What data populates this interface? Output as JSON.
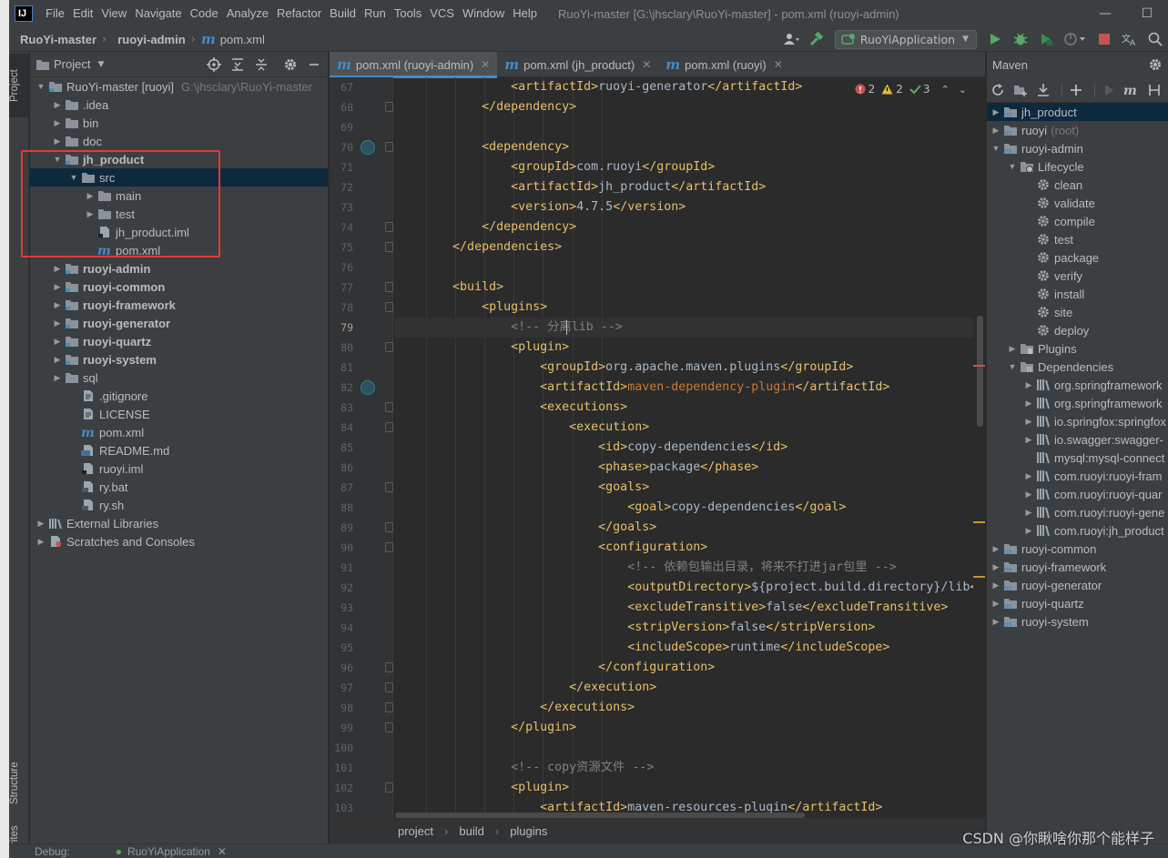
{
  "menubar": {
    "logo": "IJ",
    "items": [
      "File",
      "Edit",
      "View",
      "Navigate",
      "Code",
      "Analyze",
      "Refactor",
      "Build",
      "Run",
      "Tools",
      "VCS",
      "Window",
      "Help"
    ],
    "window_title": "RuoYi-master [G:\\jhsclary\\RuoYi-master] - pom.xml (ruoyi-admin)"
  },
  "navbar": {
    "crumbs": [
      "RuoYi-master",
      "ruoyi-admin",
      "pom.xml"
    ],
    "run_config": "RuoYiApplication"
  },
  "toolstrip": {
    "project": "Project",
    "structure": "Structure",
    "favorites": "rites"
  },
  "project": {
    "title": "Project",
    "tree": [
      {
        "label": "RuoYi-master [ruoyi]",
        "extra": "G:\\jhsclary\\RuoYi-master",
        "icon": "module-folder-icon",
        "depth": 0,
        "expanded": true,
        "bold": false
      },
      {
        "label": ".idea",
        "icon": "folder-icon",
        "depth": 1,
        "expanded": false
      },
      {
        "label": "bin",
        "icon": "folder-icon",
        "depth": 1,
        "expanded": false
      },
      {
        "label": "doc",
        "icon": "folder-icon",
        "depth": 1,
        "expanded": false
      },
      {
        "label": "jh_product",
        "icon": "module-folder-icon",
        "depth": 1,
        "expanded": true,
        "bold": true
      },
      {
        "label": "src",
        "icon": "folder-icon",
        "depth": 2,
        "expanded": true,
        "selected": true
      },
      {
        "label": "main",
        "icon": "folder-icon",
        "depth": 3,
        "expanded": false
      },
      {
        "label": "test",
        "icon": "folder-icon",
        "depth": 3,
        "expanded": false
      },
      {
        "label": "jh_product.iml",
        "icon": "iml-file-icon",
        "depth": 3,
        "leaf": true
      },
      {
        "label": "pom.xml",
        "icon": "maven-file-icon",
        "depth": 3,
        "leaf": true
      },
      {
        "label": "ruoyi-admin",
        "icon": "module-folder-icon",
        "depth": 1,
        "expanded": false,
        "bold": true
      },
      {
        "label": "ruoyi-common",
        "icon": "module-folder-icon",
        "depth": 1,
        "expanded": false,
        "bold": true
      },
      {
        "label": "ruoyi-framework",
        "icon": "module-folder-icon",
        "depth": 1,
        "expanded": false,
        "bold": true
      },
      {
        "label": "ruoyi-generator",
        "icon": "module-folder-icon",
        "depth": 1,
        "expanded": false,
        "bold": true
      },
      {
        "label": "ruoyi-quartz",
        "icon": "module-folder-icon",
        "depth": 1,
        "expanded": false,
        "bold": true
      },
      {
        "label": "ruoyi-system",
        "icon": "module-folder-icon",
        "depth": 1,
        "expanded": false,
        "bold": true
      },
      {
        "label": "sql",
        "icon": "folder-icon",
        "depth": 1,
        "expanded": false
      },
      {
        "label": ".gitignore",
        "icon": "text-file-icon",
        "depth": 2,
        "leaf": true
      },
      {
        "label": "LICENSE",
        "icon": "text-file-icon",
        "depth": 2,
        "leaf": true
      },
      {
        "label": "pom.xml",
        "icon": "maven-file-icon",
        "depth": 2,
        "leaf": true
      },
      {
        "label": "README.md",
        "icon": "markdown-file-icon",
        "depth": 2,
        "leaf": true
      },
      {
        "label": "ruoyi.iml",
        "icon": "iml-file-icon",
        "depth": 2,
        "leaf": true
      },
      {
        "label": "ry.bat",
        "icon": "script-file-icon",
        "depth": 2,
        "leaf": true
      },
      {
        "label": "ry.sh",
        "icon": "script-file-icon",
        "depth": 2,
        "leaf": true
      },
      {
        "label": "External Libraries",
        "icon": "libraries-icon",
        "depth": 0,
        "expanded": false
      },
      {
        "label": "Scratches and Consoles",
        "icon": "scratches-icon",
        "depth": 0,
        "expanded": false
      }
    ]
  },
  "editor": {
    "tabs": [
      {
        "label": "pom.xml (ruoyi-admin)",
        "active": true
      },
      {
        "label": "pom.xml (jh_product)",
        "active": false
      },
      {
        "label": "pom.xml (ruoyi)",
        "active": false
      }
    ],
    "inspections": {
      "errors": "2",
      "warnings": "2",
      "weak": "3"
    },
    "current_line": 79,
    "lines": [
      {
        "n": 67,
        "indent": 4,
        "parts": [
          [
            "t",
            "<artifactId>"
          ],
          [
            "x",
            "ruoyi-generator"
          ],
          [
            "t",
            "</artifactId>"
          ]
        ]
      },
      {
        "n": 68,
        "indent": 3,
        "parts": [
          [
            "t",
            "</dependency>"
          ]
        ]
      },
      {
        "n": 69,
        "indent": 0,
        "parts": []
      },
      {
        "n": 70,
        "indent": 3,
        "parts": [
          [
            "t",
            "<dependency>"
          ]
        ],
        "gutter_icon": true
      },
      {
        "n": 71,
        "indent": 4,
        "parts": [
          [
            "t",
            "<groupId>"
          ],
          [
            "x",
            "com.ruoyi"
          ],
          [
            "t",
            "</groupId>"
          ]
        ]
      },
      {
        "n": 72,
        "indent": 4,
        "parts": [
          [
            "t",
            "<artifactId>"
          ],
          [
            "x",
            "jh_product"
          ],
          [
            "t",
            "</artifactId>"
          ]
        ]
      },
      {
        "n": 73,
        "indent": 4,
        "parts": [
          [
            "t",
            "<version>"
          ],
          [
            "x",
            "4.7.5"
          ],
          [
            "t",
            "</version>"
          ]
        ]
      },
      {
        "n": 74,
        "indent": 3,
        "parts": [
          [
            "t",
            "</dependency>"
          ]
        ]
      },
      {
        "n": 75,
        "indent": 2,
        "parts": [
          [
            "t",
            "</dependencies>"
          ]
        ]
      },
      {
        "n": 76,
        "indent": 0,
        "parts": []
      },
      {
        "n": 77,
        "indent": 2,
        "parts": [
          [
            "t",
            "<build>"
          ]
        ]
      },
      {
        "n": 78,
        "indent": 3,
        "parts": [
          [
            "t",
            "<plugins>"
          ]
        ]
      },
      {
        "n": 79,
        "indent": 4,
        "parts": [
          [
            "c",
            "<!-- 分离lib -->"
          ]
        ]
      },
      {
        "n": 80,
        "indent": 4,
        "parts": [
          [
            "t",
            "<plugin>"
          ]
        ]
      },
      {
        "n": 81,
        "indent": 5,
        "parts": [
          [
            "t",
            "<groupId>"
          ],
          [
            "x",
            "org.apache.maven.plugins"
          ],
          [
            "t",
            "</groupId>"
          ]
        ]
      },
      {
        "n": 82,
        "indent": 5,
        "parts": [
          [
            "t",
            "<artifactId>"
          ],
          [
            "r",
            "maven-dependency-plugin"
          ],
          [
            "t",
            "</artifactId>"
          ]
        ],
        "gutter_icon": true
      },
      {
        "n": 83,
        "indent": 5,
        "parts": [
          [
            "t",
            "<executions>"
          ]
        ]
      },
      {
        "n": 84,
        "indent": 6,
        "parts": [
          [
            "t",
            "<execution>"
          ]
        ]
      },
      {
        "n": 85,
        "indent": 7,
        "parts": [
          [
            "t",
            "<id>"
          ],
          [
            "x",
            "copy-dependencies"
          ],
          [
            "t",
            "</id>"
          ]
        ]
      },
      {
        "n": 86,
        "indent": 7,
        "parts": [
          [
            "t",
            "<phase>"
          ],
          [
            "x",
            "package"
          ],
          [
            "t",
            "</phase>"
          ]
        ]
      },
      {
        "n": 87,
        "indent": 7,
        "parts": [
          [
            "t",
            "<goals>"
          ]
        ]
      },
      {
        "n": 88,
        "indent": 8,
        "parts": [
          [
            "t",
            "<goal>"
          ],
          [
            "x",
            "copy-dependencies"
          ],
          [
            "t",
            "</goal>"
          ]
        ]
      },
      {
        "n": 89,
        "indent": 7,
        "parts": [
          [
            "t",
            "</goals>"
          ]
        ]
      },
      {
        "n": 90,
        "indent": 7,
        "parts": [
          [
            "t",
            "<configuration>"
          ]
        ]
      },
      {
        "n": 91,
        "indent": 8,
        "parts": [
          [
            "c",
            "<!-- 依赖包输出目录，将来不打进jar包里 -->"
          ]
        ]
      },
      {
        "n": 92,
        "indent": 8,
        "parts": [
          [
            "t",
            "<outputDirectory>"
          ],
          [
            "x",
            "${project.build.directory}/lib"
          ],
          [
            "t",
            "</outp"
          ]
        ]
      },
      {
        "n": 93,
        "indent": 8,
        "parts": [
          [
            "t",
            "<excludeTransitive>"
          ],
          [
            "x",
            "false"
          ],
          [
            "t",
            "</excludeTransitive>"
          ]
        ]
      },
      {
        "n": 94,
        "indent": 8,
        "parts": [
          [
            "t",
            "<stripVersion>"
          ],
          [
            "x",
            "false"
          ],
          [
            "t",
            "</stripVersion>"
          ]
        ]
      },
      {
        "n": 95,
        "indent": 8,
        "parts": [
          [
            "t",
            "<includeScope>"
          ],
          [
            "x",
            "runtime"
          ],
          [
            "t",
            "</includeScope>"
          ]
        ]
      },
      {
        "n": 96,
        "indent": 7,
        "parts": [
          [
            "t",
            "</configuration>"
          ]
        ]
      },
      {
        "n": 97,
        "indent": 6,
        "parts": [
          [
            "t",
            "</execution>"
          ]
        ]
      },
      {
        "n": 98,
        "indent": 5,
        "parts": [
          [
            "t",
            "</executions>"
          ]
        ]
      },
      {
        "n": 99,
        "indent": 4,
        "parts": [
          [
            "t",
            "</plugin>"
          ]
        ]
      },
      {
        "n": 100,
        "indent": 0,
        "parts": []
      },
      {
        "n": 101,
        "indent": 4,
        "parts": [
          [
            "c",
            "<!-- copy资源文件 -->"
          ]
        ]
      },
      {
        "n": 102,
        "indent": 4,
        "parts": [
          [
            "t",
            "<plugin>"
          ]
        ]
      },
      {
        "n": 103,
        "indent": 5,
        "parts": [
          [
            "t",
            "<artifactId>"
          ],
          [
            "x",
            "maven-resources-plugin"
          ],
          [
            "t",
            "</artifactId>"
          ]
        ]
      }
    ],
    "breadcrumbs": [
      "project",
      "build",
      "plugins"
    ]
  },
  "maven": {
    "title": "Maven",
    "tree": [
      {
        "label": "jh_product",
        "depth": 0,
        "icon": "maven-module-icon",
        "expanded": false,
        "selected": true
      },
      {
        "label": "ruoyi",
        "extra": "(root)",
        "depth": 0,
        "icon": "maven-module-icon",
        "expanded": false
      },
      {
        "label": "ruoyi-admin",
        "depth": 0,
        "icon": "maven-module-icon",
        "expanded": true
      },
      {
        "label": "Lifecycle",
        "depth": 1,
        "icon": "lifecycle-folder-icon",
        "expanded": true
      },
      {
        "label": "clean",
        "depth": 2,
        "icon": "gear-icon",
        "leaf": true
      },
      {
        "label": "validate",
        "depth": 2,
        "icon": "gear-icon",
        "leaf": true
      },
      {
        "label": "compile",
        "depth": 2,
        "icon": "gear-icon",
        "leaf": true
      },
      {
        "label": "test",
        "depth": 2,
        "icon": "gear-icon",
        "leaf": true
      },
      {
        "label": "package",
        "depth": 2,
        "icon": "gear-icon",
        "leaf": true
      },
      {
        "label": "verify",
        "depth": 2,
        "icon": "gear-icon",
        "leaf": true
      },
      {
        "label": "install",
        "depth": 2,
        "icon": "gear-icon",
        "leaf": true
      },
      {
        "label": "site",
        "depth": 2,
        "icon": "gear-icon",
        "leaf": true
      },
      {
        "label": "deploy",
        "depth": 2,
        "icon": "gear-icon",
        "leaf": true
      },
      {
        "label": "Plugins",
        "depth": 1,
        "icon": "plugins-folder-icon",
        "expanded": false
      },
      {
        "label": "Dependencies",
        "depth": 1,
        "icon": "dependencies-folder-icon",
        "expanded": true
      },
      {
        "label": "org.springframework",
        "depth": 2,
        "icon": "library-icon",
        "expanded": false
      },
      {
        "label": "org.springframework",
        "depth": 2,
        "icon": "library-icon",
        "expanded": false
      },
      {
        "label": "io.springfox:springfox",
        "depth": 2,
        "icon": "library-icon",
        "expanded": false
      },
      {
        "label": "io.swagger:swagger-",
        "depth": 2,
        "icon": "library-icon",
        "expanded": false
      },
      {
        "label": "mysql:mysql-connect",
        "depth": 2,
        "icon": "library-icon",
        "leaf": true
      },
      {
        "label": "com.ruoyi:ruoyi-fram",
        "depth": 2,
        "icon": "library-icon",
        "expanded": false
      },
      {
        "label": "com.ruoyi:ruoyi-quar",
        "depth": 2,
        "icon": "library-icon",
        "expanded": false
      },
      {
        "label": "com.ruoyi:ruoyi-gene",
        "depth": 2,
        "icon": "library-icon",
        "expanded": false
      },
      {
        "label": "com.ruoyi:jh_product",
        "depth": 2,
        "icon": "library-icon",
        "expanded": false
      },
      {
        "label": "ruoyi-common",
        "depth": 0,
        "icon": "maven-module-icon",
        "expanded": false
      },
      {
        "label": "ruoyi-framework",
        "depth": 0,
        "icon": "maven-module-icon",
        "expanded": false
      },
      {
        "label": "ruoyi-generator",
        "depth": 0,
        "icon": "maven-module-icon",
        "expanded": false
      },
      {
        "label": "ruoyi-quartz",
        "depth": 0,
        "icon": "maven-module-icon",
        "expanded": false
      },
      {
        "label": "ruoyi-system",
        "depth": 0,
        "icon": "maven-module-icon",
        "expanded": false
      }
    ]
  },
  "bottom": {
    "debug_label": "Debug:",
    "debug_config": "RuoYiApplication"
  },
  "watermark": "CSDN @你瞅啥你那个能样子"
}
